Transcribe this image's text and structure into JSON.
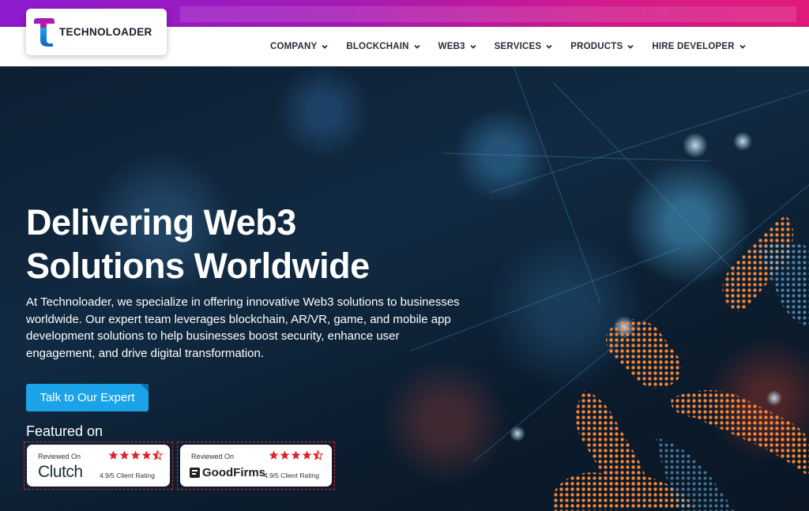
{
  "brand": {
    "name": "TECHNOLOADER"
  },
  "nav": {
    "items": [
      {
        "label": "COMPANY"
      },
      {
        "label": "BLOCKCHAIN"
      },
      {
        "label": "WEB3"
      },
      {
        "label": "SERVICES"
      },
      {
        "label": "PRODUCTS"
      },
      {
        "label": "HIRE DEVELOPER"
      }
    ]
  },
  "hero": {
    "headline_line1": "Delivering Web3",
    "headline_line2": "Solutions Worldwide",
    "description": "At Technoloader, we specialize in offering innovative Web3 solutions to businesses worldwide. Our expert team leverages blockchain, AR/VR, game, and mobile app development solutions to help businesses boost security, enhance user engagement, and drive digital transformation.",
    "cta_label": "Talk to Our Expert",
    "featured_label": "Featured on"
  },
  "badges": [
    {
      "reviewed_label": "Reviewed On",
      "brand": "Clutch",
      "rating_text": "4.9/5 Client Rating",
      "stars": 4.5
    },
    {
      "reviewed_label": "Reviewed On",
      "brand": "GoodFirms",
      "rating_text": "4.9/5 Client Rating",
      "stars": 4.5
    }
  ],
  "colors": {
    "accent": "#1aa3e8",
    "top_gradient_start": "#8e1bd0",
    "top_gradient_end": "#e0197a",
    "star": "#e0222a",
    "nav_text": "#2b2b3a"
  }
}
